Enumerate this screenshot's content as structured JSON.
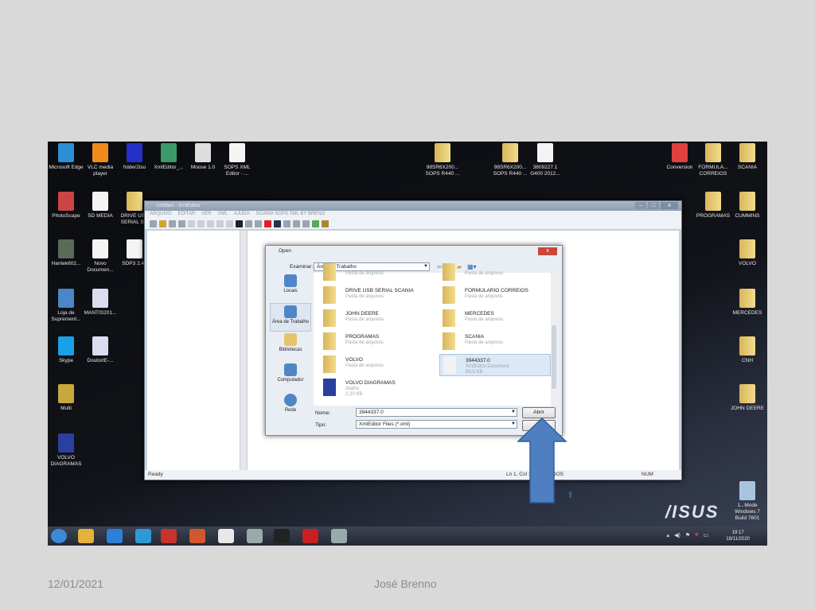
{
  "desktop": {
    "icons": [
      {
        "label": "Microsoft Edge",
        "kind": "app",
        "color": "#2b8fd6"
      },
      {
        "label": "VLC media player",
        "kind": "app",
        "color": "#f08a1c"
      },
      {
        "label": "folder2iso",
        "kind": "app",
        "color": "#2430c8"
      },
      {
        "label": "XmlEditor_...",
        "kind": "app",
        "color": "#3c9a6a"
      },
      {
        "label": "Moose 1.0",
        "kind": "app",
        "color": "#ddd"
      },
      {
        "label": "SOPS XML Editor - ...",
        "kind": "file",
        "color": "#f4f4f4"
      },
      {
        "label": "PhotoScape",
        "kind": "app",
        "color": "#c44"
      },
      {
        "label": "SD MEDIA",
        "kind": "file",
        "color": "#f4f4f4"
      },
      {
        "label": "DRIVE USB SERIAL S...",
        "kind": "folder",
        "color": "#e8c46a"
      },
      {
        "label": "Hantek602...",
        "kind": "app",
        "color": "#5a6b5a"
      },
      {
        "label": "Novo Documen...",
        "kind": "file",
        "color": "#f4f4f4"
      },
      {
        "label": "SDP3 2.45",
        "kind": "file",
        "color": "#f4f4f4"
      },
      {
        "label": "Loja de Suprement...",
        "kind": "app",
        "color": "#4a86c8"
      },
      {
        "label": "MANTIS201...",
        "kind": "file",
        "color": "#dcdcf0"
      },
      {
        "label": "Skype",
        "kind": "app",
        "color": "#1aa0e8"
      },
      {
        "label": "DoutorIE-...",
        "kind": "file",
        "color": "#dcdcf0"
      },
      {
        "label": "Multi",
        "kind": "app",
        "color": "#c8a83c"
      },
      {
        "label": "VOLVO DIAGRAMAS",
        "kind": "app",
        "color": "#2a3f9e"
      },
      {
        "label": "98SR6X200... SOPS R440 ...",
        "kind": "folder",
        "color": "#e8c46a"
      },
      {
        "label": "98SR6X200... SOPS R440 ...",
        "kind": "folder",
        "color": "#e8c46a"
      },
      {
        "label": "3809227.1 G400 2012...",
        "kind": "file",
        "color": "#f4f4f4"
      },
      {
        "label": "Conversion",
        "kind": "file",
        "color": "#e04040"
      },
      {
        "label": "FORMULA... CORREIOS",
        "kind": "folder",
        "color": "#e8c46a"
      },
      {
        "label": "SCANIA",
        "kind": "folder",
        "color": "#e8c46a"
      },
      {
        "label": "PROGRAMAS",
        "kind": "folder",
        "color": "#e8c46a"
      },
      {
        "label": "CUMMINS",
        "kind": "folder",
        "color": "#e8c46a"
      },
      {
        "label": "VOLVO",
        "kind": "folder",
        "color": "#e8c46a"
      },
      {
        "label": "MERCEDES",
        "kind": "folder",
        "color": "#e8c46a"
      },
      {
        "label": "CNH",
        "kind": "folder",
        "color": "#e8c46a"
      },
      {
        "label": "JOHN DEERE",
        "kind": "folder",
        "color": "#e8c46a"
      }
    ],
    "watermark": {
      "line1": "1...Mode",
      "line2": "Windows 7",
      "line3": "Build 7601"
    },
    "brand": "/ISUS"
  },
  "window": {
    "title": "Untitled - XmlEditor",
    "menu": [
      "ARQUIVO",
      "EDITAR",
      "VER",
      "XML",
      "AJUDA",
      "SCANIA SOPS XML BY BRENO"
    ],
    "status": {
      "ready": "Ready",
      "position": "Ln 1, Col 1",
      "encoding": "DOS",
      "num": "NUM"
    }
  },
  "dialog": {
    "title": "Open",
    "lookin_label": "Examinar:",
    "lookin_value": "Área de Trabalho",
    "places": [
      "Locais",
      "Área de Trabalho",
      "Bibliotecas",
      "Computador",
      "Rede"
    ],
    "files": [
      {
        "name": "",
        "type": "Pasta de arquivos"
      },
      {
        "name": "",
        "type": "Pasta de arquivos"
      },
      {
        "name": "DRIVE USB SERIAL SCANIA",
        "type": "Pasta de arquivos"
      },
      {
        "name": "FORMULARIO CORREIOS",
        "type": "Pasta de arquivos"
      },
      {
        "name": "JOHN DEERE",
        "type": "Pasta de arquivos"
      },
      {
        "name": "MERCEDES",
        "type": "Pasta de arquivos"
      },
      {
        "name": "PROGRAMAS",
        "type": "Pasta de arquivos"
      },
      {
        "name": "SCANIA",
        "type": "Pasta de arquivos"
      },
      {
        "name": "VOLVO",
        "type": "Pasta de arquivos"
      },
      {
        "name": "3944337.0",
        "type": "XmlEditor.Document",
        "size": "89,5 KB",
        "selected": true
      },
      {
        "name": "VOLVO DIAGRAMAS",
        "type": "Atalho",
        "size": "2,20 KB"
      }
    ],
    "name_label": "Nome:",
    "name_value": "3944337.0",
    "type_label": "Tipo:",
    "type_value": "XmlEditor Files (*.xml)",
    "open_button": "Abrir",
    "cancel_button": ""
  },
  "taskbar": {
    "time": "19:17",
    "date": "18/11/2020",
    "apps": [
      "start",
      "chrome",
      "ie",
      "edge",
      "antivirus",
      "powerpoint",
      "notepad",
      "obd",
      "sdp3",
      "acrobat",
      "obd2"
    ]
  },
  "footer": {
    "date": "12/01/2021",
    "author": "José Brenno"
  },
  "colors": {
    "arrow": "#4f7fc0",
    "slide_bg": "#d9d9d9"
  }
}
